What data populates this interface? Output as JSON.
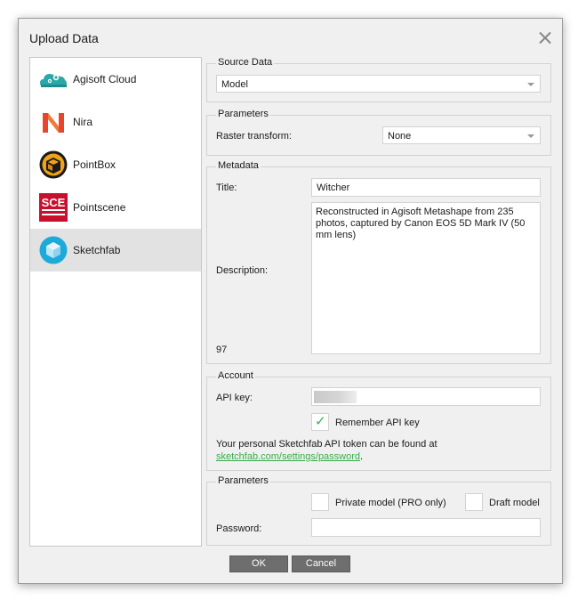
{
  "dialog": {
    "title": "Upload Data"
  },
  "sidebar": {
    "items": [
      {
        "label": "Agisoft Cloud",
        "icon": "agisoft-cloud-icon"
      },
      {
        "label": "Nira",
        "icon": "nira-logo-icon"
      },
      {
        "label": "PointBox",
        "icon": "pointbox-logo-icon"
      },
      {
        "label": "Pointscene",
        "icon": "pointscene-logo-icon"
      },
      {
        "label": "Sketchfab",
        "icon": "sketchfab-logo-icon",
        "selected": true
      }
    ]
  },
  "source_data": {
    "group_label": "Source Data",
    "value": "Model"
  },
  "parameters": {
    "group_label": "Parameters",
    "raster_transform_label": "Raster transform:",
    "raster_transform_value": "None"
  },
  "metadata": {
    "group_label": "Metadata",
    "title_label": "Title:",
    "title_value": "Witcher",
    "description_label": "Description:",
    "description_value": "Reconstructed in Agisoft Metashape from 235 photos, captured by Canon EOS 5D Mark IV (50 mm lens)",
    "char_count": "97"
  },
  "account": {
    "group_label": "Account",
    "api_key_label": "API key:",
    "remember_label": "Remember API key",
    "remember_checked": true,
    "info_text": "Your personal Sketchfab API token can be found at",
    "link_text": "sketchfab.com/settings/password",
    "link_suffix": "."
  },
  "parameters2": {
    "group_label": "Parameters",
    "private_label": "Private model (PRO only)",
    "draft_label": "Draft model",
    "password_label": "Password:"
  },
  "buttons": {
    "ok": "OK",
    "cancel": "Cancel"
  },
  "colors": {
    "accent_green": "#3aab49",
    "selection": "#e2e2e2",
    "button": "#6e6e6e"
  }
}
